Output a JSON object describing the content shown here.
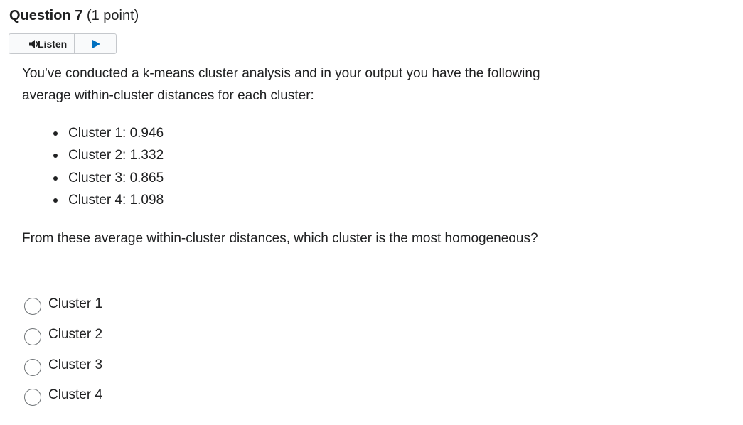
{
  "question": {
    "title": "Question 7",
    "points": "(1 point)"
  },
  "listen": {
    "label": "Listen",
    "icon": "speaker-icon",
    "play_icon": "play-icon",
    "accent_color": "#006fbf"
  },
  "prompt": {
    "intro": "You've conducted a k-means cluster analysis and in your output you have the following average within-cluster distances for each cluster:",
    "bullets": [
      "Cluster 1: 0.946",
      "Cluster 2: 1.332",
      "Cluster 3: 0.865",
      "Cluster 4: 1.098"
    ],
    "question": "From these average within-cluster distances, which cluster is the most homogeneous?"
  },
  "options": [
    {
      "label": "Cluster 1",
      "selected": false
    },
    {
      "label": "Cluster 2",
      "selected": false
    },
    {
      "label": "Cluster 3",
      "selected": false
    },
    {
      "label": "Cluster 4",
      "selected": false
    }
  ]
}
